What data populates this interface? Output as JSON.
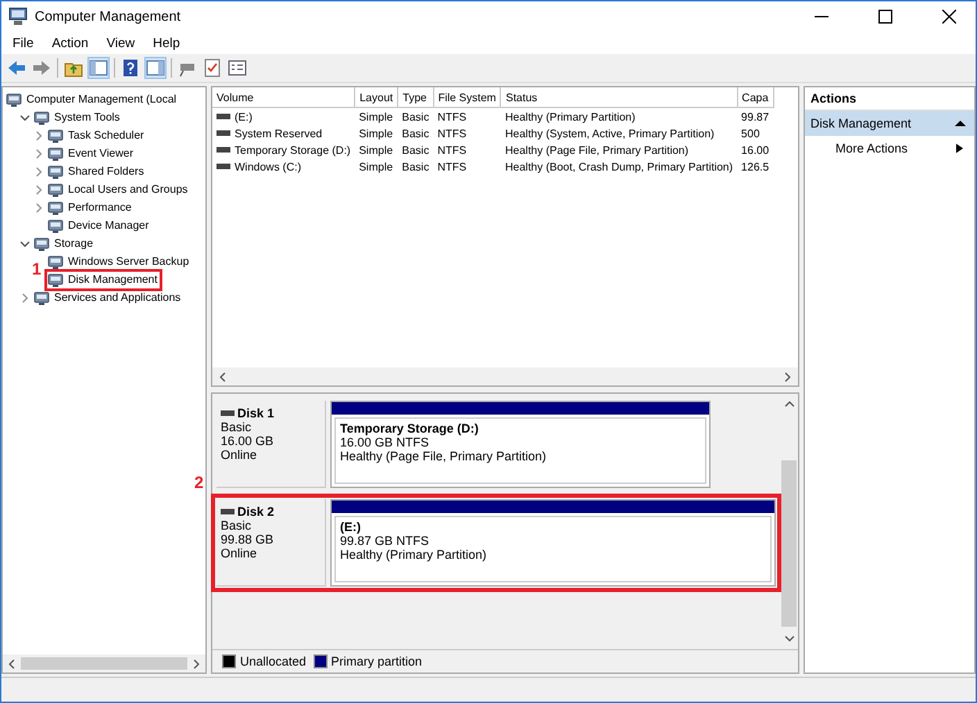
{
  "window": {
    "title": "Computer Management"
  },
  "menu": [
    "File",
    "Action",
    "View",
    "Help"
  ],
  "tree": [
    {
      "label": "Computer Management (Local",
      "children": [
        {
          "label": "System Tools",
          "expanded": true,
          "children": [
            {
              "label": "Task Scheduler",
              "expanded": false
            },
            {
              "label": "Event Viewer",
              "expanded": false
            },
            {
              "label": "Shared Folders",
              "expanded": false
            },
            {
              "label": "Local Users and Groups",
              "expanded": false
            },
            {
              "label": "Performance",
              "expanded": false
            },
            {
              "label": "Device Manager"
            }
          ]
        },
        {
          "label": "Storage",
          "expanded": true,
          "children": [
            {
              "label": "Windows Server Backup"
            },
            {
              "label": "Disk Management",
              "callout": "1"
            }
          ]
        },
        {
          "label": "Services and Applications",
          "expanded": false
        }
      ]
    }
  ],
  "volumes": {
    "columns": [
      "Volume",
      "Layout",
      "Type",
      "File System",
      "Status",
      "Capa"
    ],
    "rows": [
      [
        "(E:)",
        "Simple",
        "Basic",
        "NTFS",
        "Healthy (Primary Partition)",
        "99.87"
      ],
      [
        "System Reserved",
        "Simple",
        "Basic",
        "NTFS",
        "Healthy (System, Active, Primary Partition)",
        "500"
      ],
      [
        "Temporary Storage (D:)",
        "Simple",
        "Basic",
        "NTFS",
        "Healthy (Page File, Primary Partition)",
        "16.00"
      ],
      [
        "Windows (C:)",
        "Simple",
        "Basic",
        "NTFS",
        "Healthy (Boot, Crash Dump, Primary Partition)",
        "126.5"
      ]
    ]
  },
  "disks": [
    {
      "name": "Disk 1",
      "type": "Basic",
      "size": "16.00 GB",
      "status": "Online",
      "partitions": [
        {
          "label": "Temporary Storage  (D:)",
          "size": "16.00 GB NTFS",
          "status": "Healthy (Page File, Primary Partition)"
        }
      ]
    },
    {
      "name": "Disk 2",
      "type": "Basic",
      "size": "99.88 GB",
      "status": "Online",
      "callout": "2",
      "partitions": [
        {
          "label": "(E:)",
          "size": "99.87 GB NTFS",
          "status": "Healthy (Primary Partition)"
        }
      ]
    }
  ],
  "legend": [
    {
      "label": "Unallocated",
      "color": "#000000"
    },
    {
      "label": "Primary partition",
      "color": "#000080"
    }
  ],
  "actions": {
    "title": "Actions",
    "section": {
      "label": "Disk Management",
      "expanded": true
    },
    "items": [
      "More Actions"
    ]
  }
}
